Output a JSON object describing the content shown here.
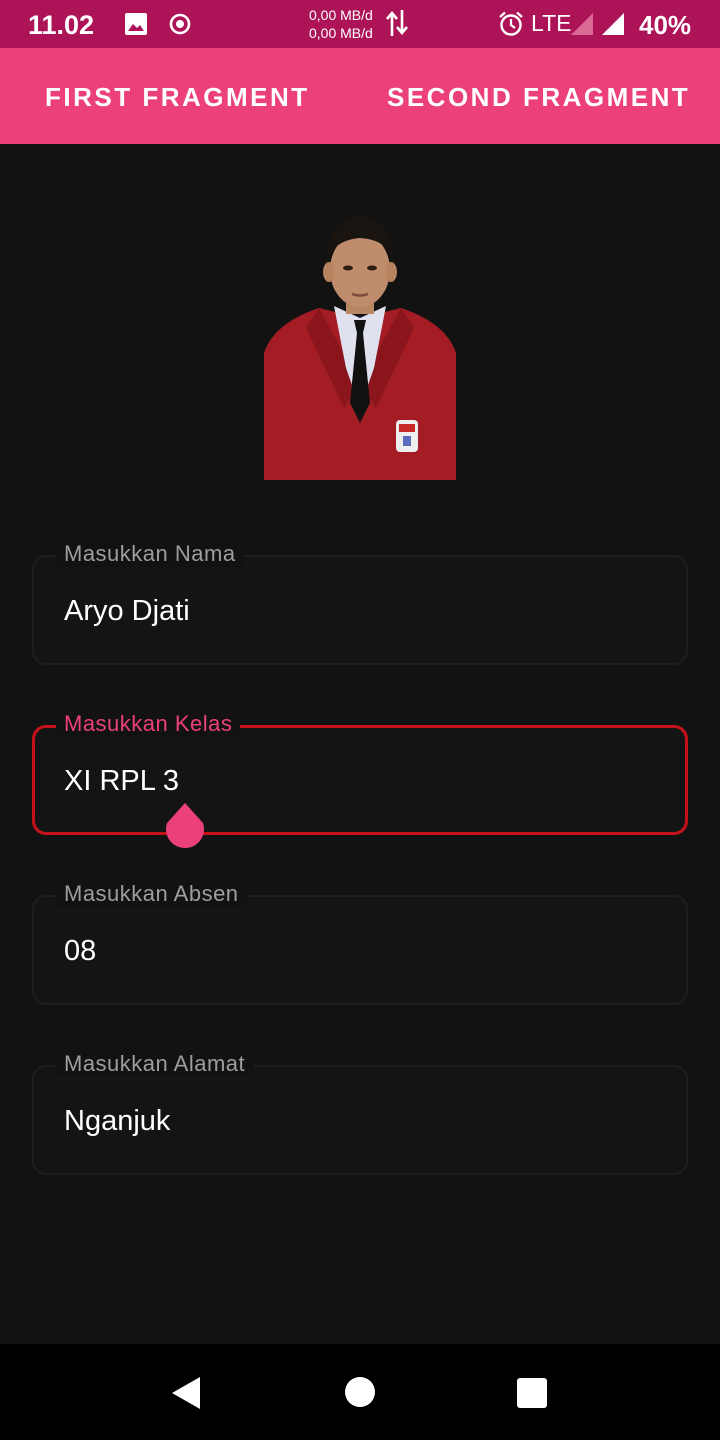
{
  "status_bar": {
    "time": "11.02",
    "net_speed_up": "0,00 MB/d",
    "net_speed_down": "0,00 MB/d",
    "network_type": "LTE",
    "battery": "40%",
    "icons": [
      "image-icon",
      "record-icon",
      "data-arrows-icon",
      "alarm-icon",
      "signal-icon",
      "signal-full-icon"
    ]
  },
  "tabs": [
    {
      "label": "FIRST FRAGMENT"
    },
    {
      "label": "SECOND FRAGMENT"
    }
  ],
  "form": {
    "nama": {
      "label": "Masukkan Nama",
      "value": "Aryo Djati"
    },
    "kelas": {
      "label": "Masukkan Kelas",
      "value": "XI RPL 3"
    },
    "absen": {
      "label": "Masukkan Absen",
      "value": "08"
    },
    "alamat": {
      "label": "Masukkan Alamat",
      "value": "Nganjuk"
    }
  },
  "colors": {
    "status_bar": "#ad1457",
    "app_bar": "#ec407a",
    "accent": "#ec407a",
    "focus_border": "#c5121a",
    "background": "#121212"
  },
  "nav_bar": {
    "icons": [
      "back-icon",
      "home-icon",
      "recents-icon"
    ]
  }
}
